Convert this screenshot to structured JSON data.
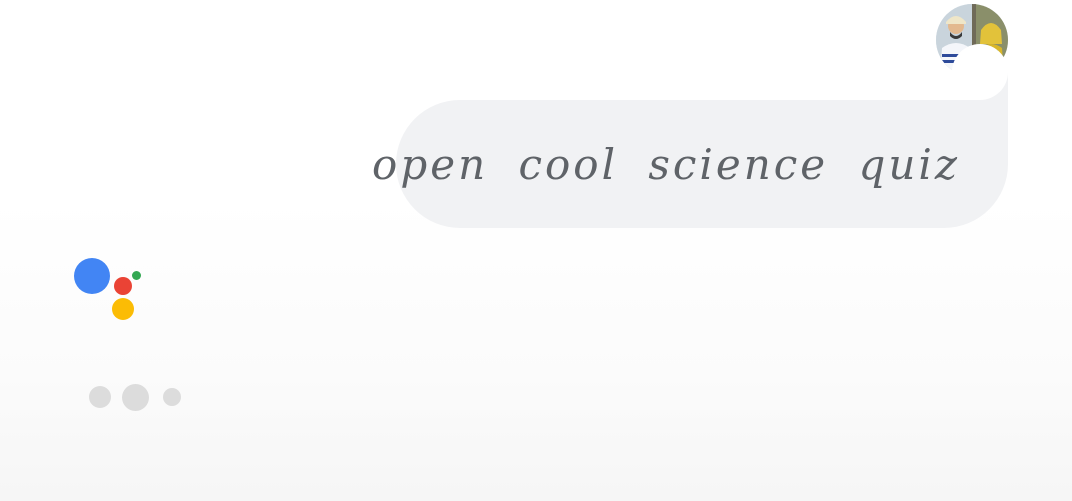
{
  "conversation": {
    "user_query": "open cool science quiz"
  },
  "user": {
    "avatar_icon": "user-avatar-photo"
  },
  "assistant": {
    "logo_icon": "google-assistant-logo",
    "logo_colors": {
      "blue": "#4285f4",
      "red": "#ea4335",
      "yellow": "#fbbc05",
      "green": "#34a853"
    },
    "status_icon": "typing-indicator-icon"
  },
  "colors": {
    "bubble_background": "#f1f2f4",
    "query_text": "#5f6368",
    "typing_dots": "#dcdcdc"
  }
}
